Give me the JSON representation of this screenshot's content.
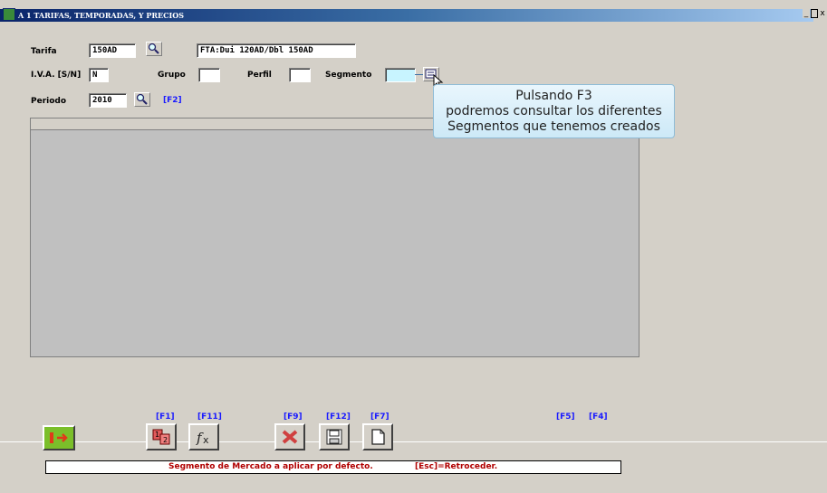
{
  "window": {
    "title": "A 1  TARIFAS, TEMPORADAS, Y PRECIOS",
    "controls": [
      "_",
      " ",
      "x"
    ],
    "title_gradient_start": "#0a246a",
    "title_gradient_end": "#a6caf0"
  },
  "form": {
    "tarifa_label": "Tarifa",
    "tarifa_value": "150AD",
    "tarifa_desc": "FTA:Dui 120AD/Dbl 150AD",
    "iva_label": "I.V.A. [S/N]",
    "iva_value": "N",
    "grupo_label": "Grupo",
    "grupo_value": "",
    "perfil_label": "Perfil",
    "perfil_value": "",
    "segmento_label": "Segmento",
    "segmento_value": "",
    "periodo_label": "Periodo",
    "periodo_value": "2010",
    "periodo_fkey": "[F2]"
  },
  "tooltip": {
    "line1": "Pulsando F3",
    "line2": "podremos consultar los diferentes",
    "line3": "Segmentos que tenemos creados"
  },
  "toolbar": {
    "keys": [
      "[F1]",
      "[F11]",
      "[F9]",
      "[F12]",
      "[F7]",
      "[F5]",
      "[F4]"
    ],
    "buttons": [
      "exit-icon",
      "numbered-pages-icon",
      "function-fx-icon",
      "delete-cross-icon",
      "save-floppy-icon",
      "new-page-icon"
    ]
  },
  "status": {
    "message": "Segmento de Mercado a aplicar  por defecto.",
    "hint": "[Esc]=Retroceder.",
    "color": "#b00000"
  }
}
